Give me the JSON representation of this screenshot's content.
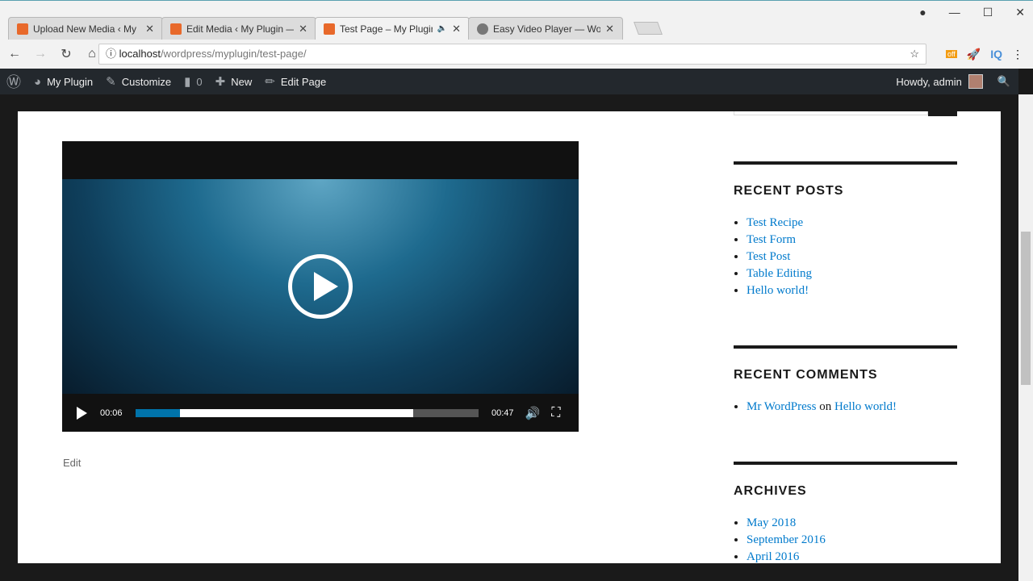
{
  "browser": {
    "tabs": [
      {
        "title": "Upload New Media ‹ My",
        "icon": "xampp-icon",
        "active": false
      },
      {
        "title": "Edit Media ‹ My Plugin —",
        "icon": "xampp-icon",
        "active": false
      },
      {
        "title": "Test Page – My Plugin",
        "icon": "xampp-icon",
        "active": true,
        "audio": true
      },
      {
        "title": "Easy Video Player — Wo",
        "icon": "wordpress-icon",
        "active": false
      }
    ],
    "url_host": "localhost",
    "url_path": "/wordpress/myplugin/test-page/",
    "ext_badge": "off",
    "ext_iq": "IQ"
  },
  "adminbar": {
    "site": "My Plugin",
    "customize": "Customize",
    "comments": "0",
    "new": "New",
    "edit": "Edit Page",
    "howdy": "Howdy, admin"
  },
  "video": {
    "current_time": "00:06",
    "duration": "00:47",
    "played_fraction": 0.13,
    "buffered_fraction": 0.81,
    "accent": "#0073aa"
  },
  "edit_link": "Edit",
  "sidebar": {
    "recent_posts": {
      "title": "RECENT POSTS",
      "items": [
        "Test Recipe",
        "Test Form",
        "Test Post",
        "Table Editing",
        "Hello world!"
      ]
    },
    "recent_comments": {
      "title": "RECENT COMMENTS",
      "author": "Mr WordPress",
      "on": "on",
      "post": "Hello world!"
    },
    "archives": {
      "title": "ARCHIVES",
      "items": [
        "May 2018",
        "September 2016",
        "April 2016"
      ]
    }
  }
}
